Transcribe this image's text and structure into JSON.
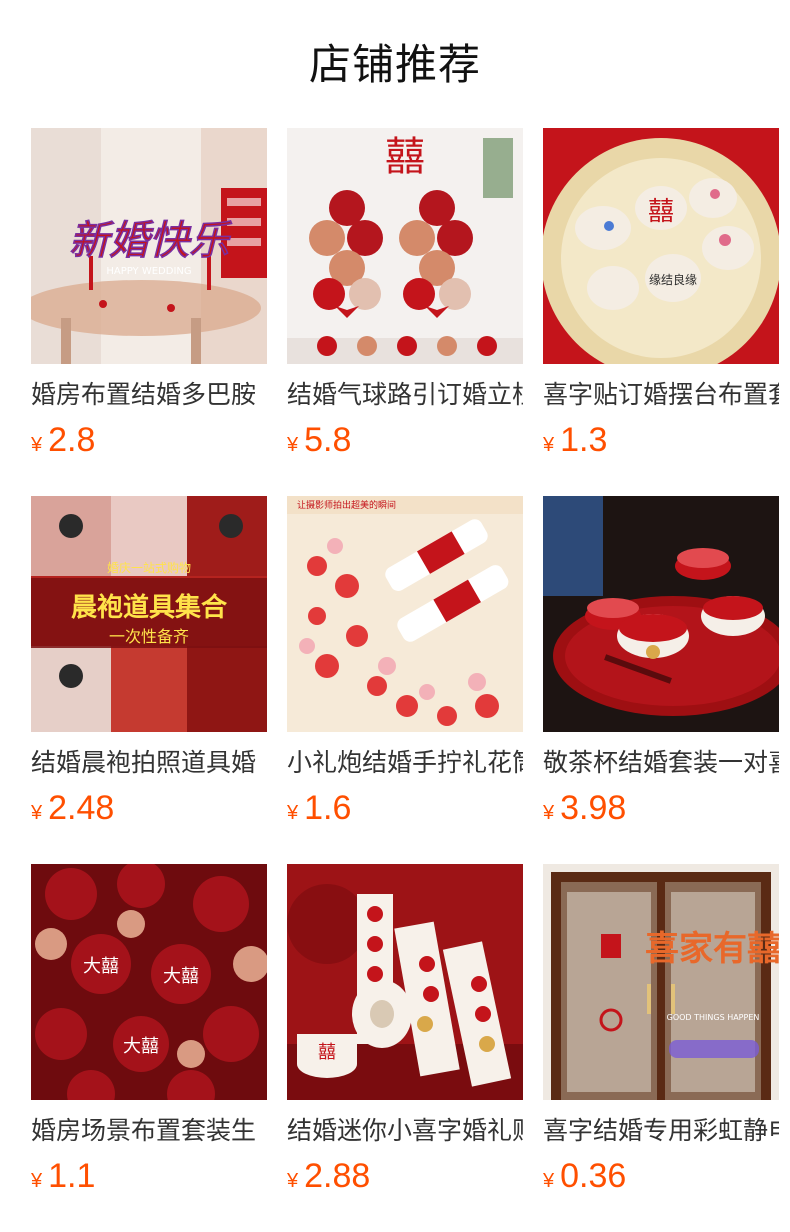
{
  "section": {
    "title": "店铺推荐"
  },
  "theme": {
    "price_color": "#ff4f00",
    "text_color": "#333333",
    "festive_red": "#c4141b"
  },
  "products": [
    {
      "title": "婚房布置结婚多巴胺",
      "currency": "¥",
      "price": "2.8",
      "image_icon": "wedding-cake-topper-image",
      "image_text": "新婚快乐",
      "image_subtext": "HAPPY WEDDING"
    },
    {
      "title": "结婚气球路引订婚立柱",
      "currency": "¥",
      "price": "5.8",
      "image_icon": "balloon-columns-image",
      "image_text": "囍"
    },
    {
      "title": "喜字贴订婚摆台布置套",
      "currency": "¥",
      "price": "1.3",
      "image_icon": "decorated-eggs-image",
      "image_text": "囍",
      "image_subtext": "缘结良缘"
    },
    {
      "title": "结婚晨袍拍照道具婚",
      "currency": "¥",
      "price": "2.48",
      "image_icon": "morning-robe-props-image",
      "image_text": "晨袍道具集合",
      "image_subtext": "一次性备齐",
      "image_caption": "婚庆一站式购物"
    },
    {
      "title": "小礼炮结婚手拧礼花筒",
      "currency": "¥",
      "price": "1.6",
      "image_icon": "confetti-poppers-image",
      "image_caption": "让摄影师拍出超美的瞬间"
    },
    {
      "title": "敬茶杯结婚套装一对喜",
      "currency": "¥",
      "price": "3.98",
      "image_icon": "tea-cup-set-image"
    },
    {
      "title": "婚房场景布置套装生",
      "currency": "¥",
      "price": "1.1",
      "image_icon": "red-balloons-image",
      "image_text": "大囍"
    },
    {
      "title": "结婚迷你小喜字婚礼贴",
      "currency": "¥",
      "price": "2.88",
      "image_icon": "sticker-rolls-image",
      "image_text": "囍"
    },
    {
      "title": "喜字结婚专用彩虹静电",
      "currency": "¥",
      "price": "0.36",
      "image_icon": "rainbow-window-sticker-image",
      "image_text": "喜家有囍",
      "image_subtext": "GOOD THINGS HAPPEN"
    }
  ]
}
